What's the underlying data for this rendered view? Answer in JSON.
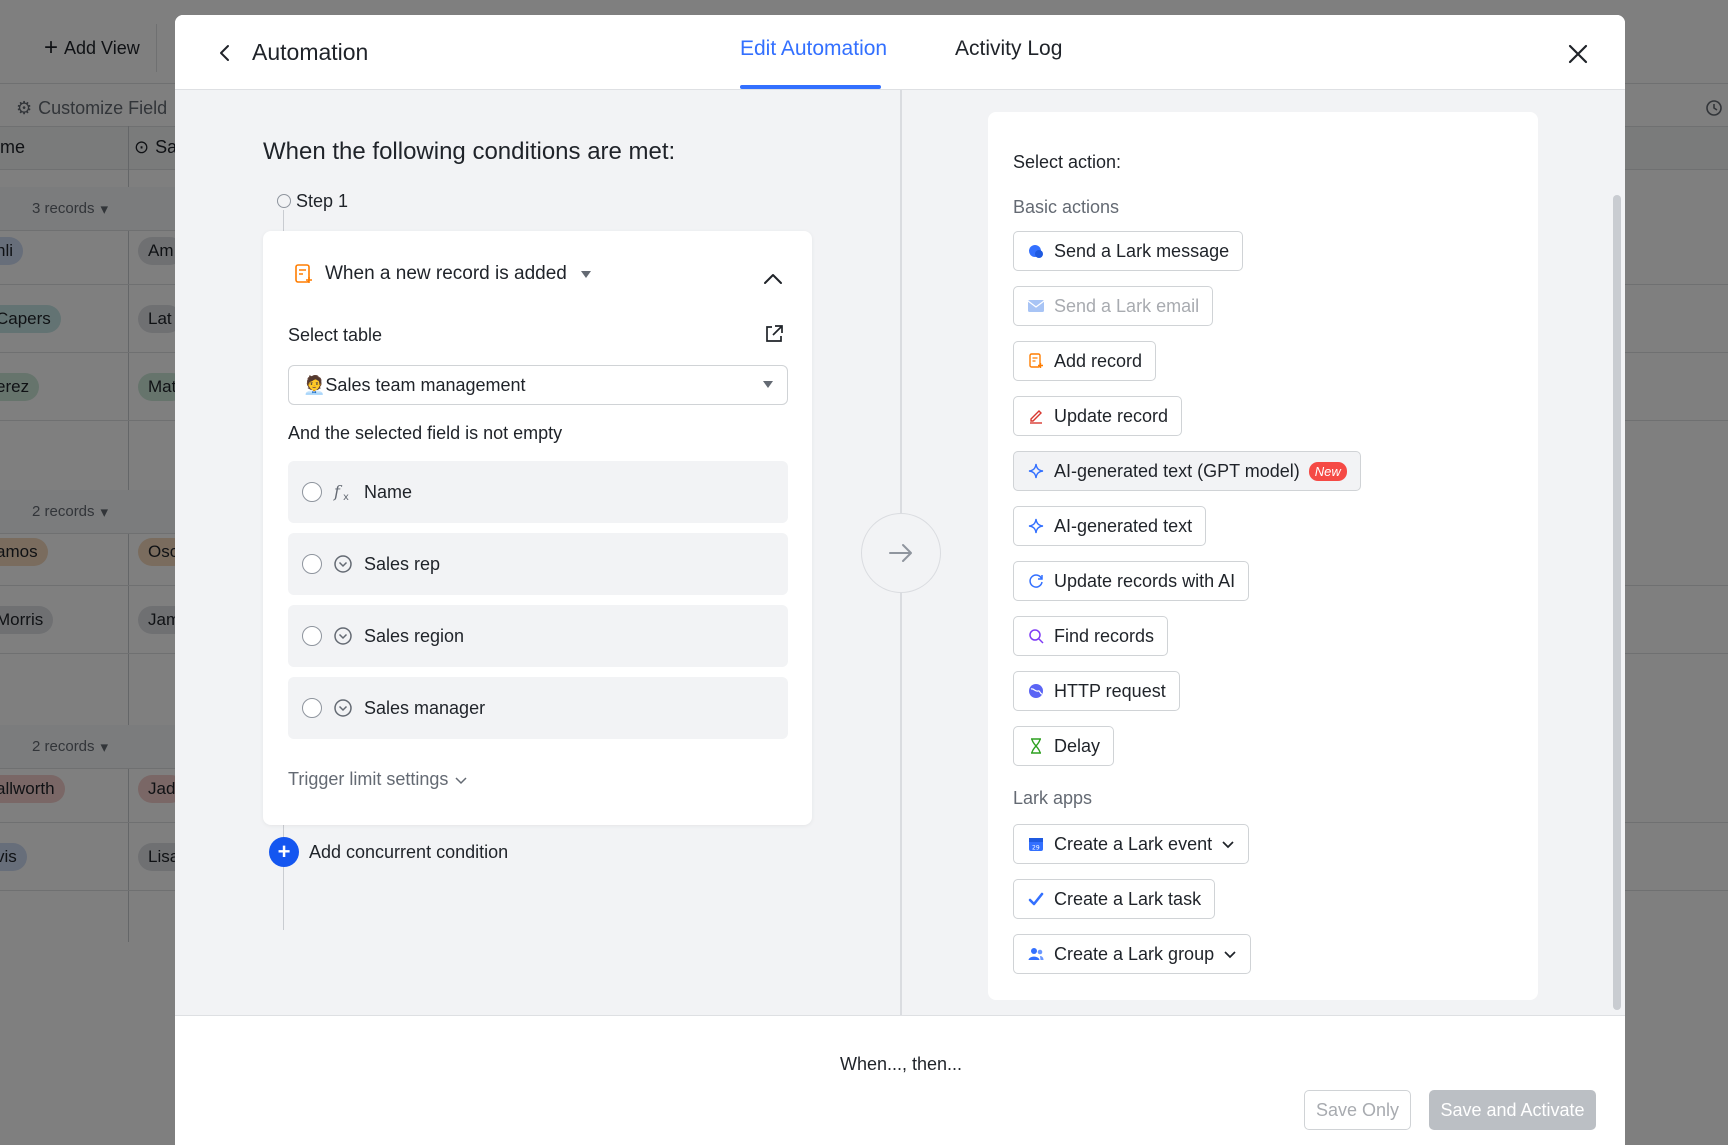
{
  "background": {
    "add_view": "Add View",
    "customize_field": "Customize Field",
    "col1_header": "me",
    "col2_header": "Sa",
    "groups": [
      "3 records",
      "2 records",
      "2 records"
    ],
    "rows": [
      {
        "a": "nli",
        "b": "Am"
      },
      {
        "a": "Capers",
        "b": "Lat"
      },
      {
        "a": "erez",
        "b": "Mat"
      },
      {
        "a": "amos",
        "b": "Osc"
      },
      {
        "a": "Morris",
        "b": "Jam"
      },
      {
        "a": "allworth",
        "b": "Jad"
      },
      {
        "a": "vis",
        "b": "Lisa"
      }
    ]
  },
  "modal": {
    "title": "Automation",
    "tabs": [
      {
        "label": "Edit Automation",
        "active": true
      },
      {
        "label": "Activity Log",
        "active": false
      }
    ],
    "accent": "#3370ff"
  },
  "trigger": {
    "heading": "When the following conditions are met:",
    "step_label": "Step 1",
    "type": "When a new record is added",
    "select_table_label": "Select table",
    "table_emoji": "🧑‍💼",
    "table_value": "Sales team management",
    "field_condition_label": "And the selected field is not empty",
    "fields": [
      {
        "label": "Name",
        "icon": "formula-icon",
        "selected": false
      },
      {
        "label": "Sales rep",
        "icon": "single-select-icon",
        "selected": false
      },
      {
        "label": "Sales region",
        "icon": "single-select-icon",
        "selected": false
      },
      {
        "label": "Sales manager",
        "icon": "single-select-icon",
        "selected": false
      }
    ],
    "trigger_limit": "Trigger limit settings",
    "add_condition": "Add concurrent condition"
  },
  "actions": {
    "select_label": "Select action:",
    "basic_label": "Basic actions",
    "basic": [
      {
        "label": "Send a Lark message",
        "icon": "lark-message-icon",
        "color": "#3370ff"
      },
      {
        "label": "Send a Lark email",
        "icon": "email-icon",
        "color": "#a8c4f5",
        "disabled": true
      },
      {
        "label": "Add record",
        "icon": "add-record-icon",
        "color": "#ff7d00"
      },
      {
        "label": "Update record",
        "icon": "edit-icon",
        "color": "#d83931"
      },
      {
        "label": "AI-generated text (GPT model)",
        "icon": "sparkle-icon",
        "color": "#3370ff",
        "badge": "New"
      },
      {
        "label": "AI-generated text",
        "icon": "sparkle-icon",
        "color": "#3370ff"
      },
      {
        "label": "Update records with AI",
        "icon": "refresh-icon",
        "color": "#3370ff"
      },
      {
        "label": "Find records",
        "icon": "search-icon",
        "color": "#7f3bf5"
      },
      {
        "label": "HTTP request",
        "icon": "globe-icon",
        "color": "#5b65f5"
      },
      {
        "label": "Delay",
        "icon": "hourglass-icon",
        "color": "#2ea121"
      }
    ],
    "apps_label": "Lark apps",
    "apps": [
      {
        "label": "Create a Lark event",
        "icon": "calendar-icon",
        "color": "#3370ff",
        "has_dropdown": true
      },
      {
        "label": "Create a Lark task",
        "icon": "task-check-icon",
        "color": "#3370ff",
        "has_dropdown": false
      },
      {
        "label": "Create a Lark group",
        "icon": "group-icon",
        "color": "#3370ff",
        "has_dropdown": true
      }
    ]
  },
  "footer": {
    "summary": "When..., then...",
    "save_only": "Save Only",
    "save_activate": "Save and Activate"
  }
}
